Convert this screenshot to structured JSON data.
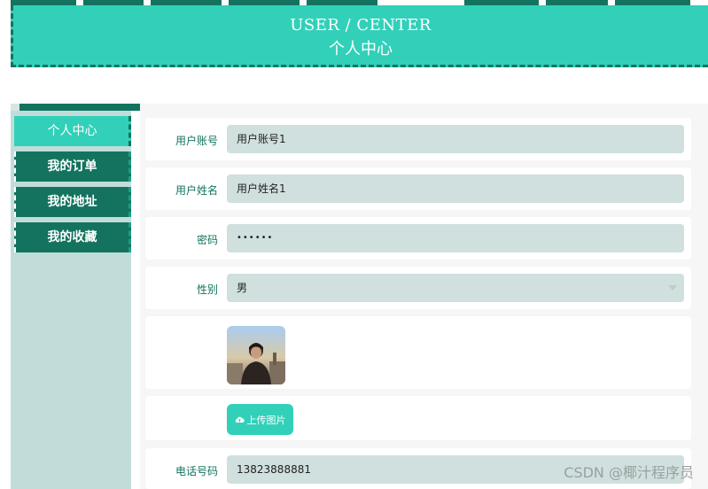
{
  "header": {
    "title_en": "USER / CENTER",
    "title_cn": "个人中心"
  },
  "sidebar": {
    "items": [
      {
        "label": "个人中心",
        "active": true
      },
      {
        "label": "我的订单",
        "active": false
      },
      {
        "label": "我的地址",
        "active": false
      },
      {
        "label": "我的收藏",
        "active": false
      }
    ]
  },
  "form": {
    "account": {
      "label": "用户账号",
      "value": "用户账号1"
    },
    "name": {
      "label": "用户姓名",
      "value": "用户姓名1"
    },
    "password": {
      "label": "密码",
      "value": "••••••"
    },
    "gender": {
      "label": "性别",
      "value": "男"
    },
    "upload_label": "上传图片",
    "phone": {
      "label": "电话号码",
      "value": "13823888881"
    }
  },
  "watermark": "CSDN @椰汁程序员",
  "colors": {
    "accent": "#32d0b9",
    "dark": "#13735f",
    "field_bg": "#cfe0de"
  }
}
